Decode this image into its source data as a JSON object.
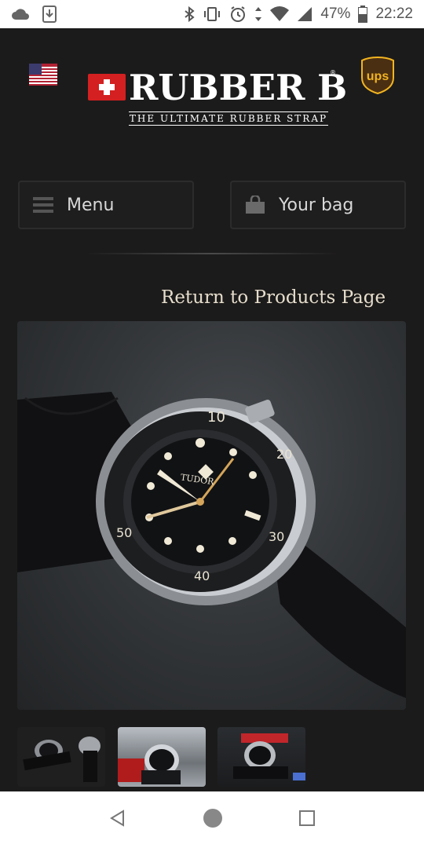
{
  "status_bar": {
    "battery": "47%",
    "time": "22:22",
    "icons": [
      "cloud-icon",
      "download-icon",
      "bluetooth-icon",
      "vibrate-icon",
      "alarm-icon",
      "data-arrows-icon",
      "wifi-icon",
      "signal-icon",
      "battery-icon"
    ]
  },
  "header": {
    "flag_icon": "us-flag-icon",
    "brand": "RUBBER B",
    "registered": "®",
    "tagline": "THE ULTIMATE RUBBER STRAP",
    "shipping_logo_text": "ups",
    "colors": {
      "swiss_red": "#d42020",
      "ups_brown": "#4b2f12",
      "ups_gold": "#f1b421"
    }
  },
  "nav_buttons": {
    "menu_label": "Menu",
    "bag_label": "Your bag"
  },
  "return_link": "Return to Products Page",
  "product_image": {
    "watch_brand": "TUDOR",
    "bezel_numbers": [
      "10",
      "20",
      "30",
      "40",
      "50"
    ]
  },
  "thumbnails": [
    "thumbnail-1",
    "thumbnail-2",
    "thumbnail-3"
  ],
  "android_nav": [
    "back-icon",
    "home-icon",
    "recents-icon"
  ]
}
